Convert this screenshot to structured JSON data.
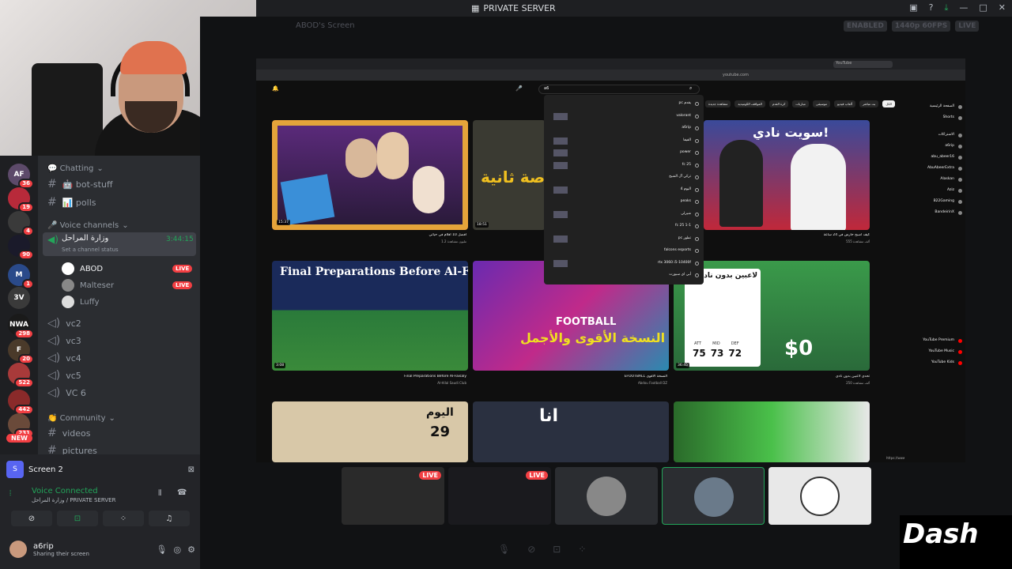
{
  "window": {
    "title": "PRIVATE SERVER"
  },
  "stream": {
    "streamer_label": "ABOD's Screen",
    "enabled_label": "ENABLED",
    "quality_label": "1440p 60FPS",
    "live_label": "LIVE"
  },
  "servers": [
    {
      "label": "AF",
      "badge": "36"
    },
    {
      "label": "",
      "badge": "19"
    },
    {
      "label": "",
      "badge": "4"
    },
    {
      "label": "",
      "badge": "90"
    },
    {
      "label": "M",
      "badge": "1"
    },
    {
      "label": "3V",
      "badge": ""
    },
    {
      "label": "NWA",
      "badge": "298"
    },
    {
      "label": "F",
      "badge": "20"
    },
    {
      "label": "",
      "badge": "522"
    },
    {
      "label": "",
      "badge": "442"
    },
    {
      "label": "",
      "badge": "231"
    }
  ],
  "new_badge": "NEW",
  "channels": {
    "chatting_category": "💬 Chatting",
    "bot_stuff": "🤖 bot-stuff",
    "polls": "📊 polls",
    "voice_category": "🎤 Voice channels",
    "active_vc": "وزارة المراحل",
    "active_vc_time": "3:44:15",
    "status_placeholder": "Set a channel status",
    "users": [
      {
        "name": "ABOD",
        "live": "LIVE"
      },
      {
        "name": "Malteser",
        "live": "LIVE"
      },
      {
        "name": "Luffy",
        "live": ""
      }
    ],
    "vcs": [
      "vc2",
      "vc3",
      "vc4",
      "vc5",
      "VC 6"
    ],
    "community_category": "👏 Community",
    "videos": "videos",
    "pictures": "pictures"
  },
  "panel": {
    "screen_label": "Screen 2",
    "voice_connected": "Voice Connected",
    "voice_location": "وزارة المراحل / PRIVATE SERVER",
    "username": "a6rip",
    "user_status": "Sharing their screen"
  },
  "youtube": {
    "logo": "YouTube",
    "url": "youtube.com",
    "search_value": "a6",
    "chips": [
      "الكل",
      "بث مباشر",
      "ألعاب فيديو",
      "موسيقى",
      "مباريات",
      "كرة القدم",
      "المواقف الكوميدية",
      "مشاهدة جديدة"
    ],
    "suggestions": [
      "pc يقدم",
      "valorant",
      "a6rip",
      "الفيفا",
      "power",
      "fc 25",
      "تركي آل الشيخ",
      "4 اليوم",
      "peaks",
      "شيرلي",
      "fc 25 1-1",
      "pc تطور",
      "falcons esports",
      "rtx 3060 i5-10400f",
      "أبي اي سبورت"
    ],
    "sidebar": [
      "الصفحة الرئيسية",
      "Shorts",
      "الاشتراكات",
      "a6rip",
      "abu_abeer16",
      "AbuAbeerExtra",
      "Alaskan",
      "Aziz",
      "B22Gaming",
      "BandeirinX",
      "YouTube Premium",
      "YouTube Music",
      "YouTube Kids"
    ],
    "videos": [
      {
        "duration": "15:37",
        "title": "أفضل 10 أفلام في حياتي",
        "meta": "1.2 مليون مشاهدة"
      },
      {
        "duration": "18:51",
        "title": "فرصة ثانية",
        "meta": "300 ألف مشاهدة"
      },
      {
        "duration": "",
        "title": "كيف أصبح حارس في 24 ساعة",
        "meta": "555 ألف مشاهدة"
      },
      {
        "duration": "3:08",
        "title": "Final Preparations Before Al-Faisaly",
        "meta": "Al-Hilal Saudi Club"
      },
      {
        "duration": "",
        "title": "EFOOTBALL النسخة الأقوى",
        "meta": "Abdou Football DZ"
      },
      {
        "duration": "36:45",
        "title": "تحدي لاعبين بدون نادي",
        "meta": "250 ألف مشاهدة"
      }
    ],
    "thumb_text": {
      "final": "Final Preparations Before Al-Faisaly",
      "efootball": "FOOTBALL",
      "efootball_ar": "النسخة الأقوى والأجمل",
      "players": "لاعبين بدون نادي",
      "sale": "$0",
      "stats": [
        "75",
        "73",
        "72"
      ],
      "stat_labels": [
        "ATT",
        "MID",
        "DEF"
      ],
      "day": "اليوم",
      "day_num": "29",
      "ana": "انا",
      "sawt": "سويت نادي!",
      "forsa": "فرصة ثانية",
      "url_status": "https://www.youtube.com/watch?v=8Dr1nXgMoxe"
    }
  },
  "tiles": [
    {
      "live": "LIVE"
    },
    {
      "live": "LIVE"
    },
    {
      "live": ""
    },
    {
      "live": ""
    },
    {
      "live": ""
    }
  ],
  "watermark": "Dash"
}
